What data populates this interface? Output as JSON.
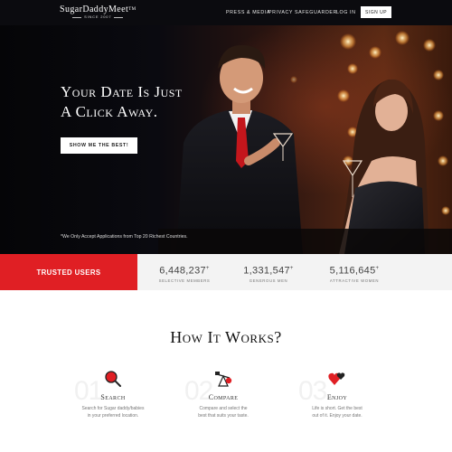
{
  "header": {
    "logo_text": "SugarDaddyMeet",
    "logo_tm": "TM",
    "logo_since": "SINCE 2007",
    "nav_press": "PRESS & MEDIA",
    "nav_privacy": "PRIVACY SAFEGUARDER",
    "nav_login": "LOG IN",
    "signup_label": "SIGN UP"
  },
  "hero": {
    "title_line1": "Your Date Is Just",
    "title_line2": "A Click Away.",
    "cta_label": "SHOW ME THE BEST!",
    "note": "*We Only Accept Applications from Top 20 Richest Countries."
  },
  "stats": {
    "trusted_label": "TRUSTED USERS",
    "items": [
      {
        "value": "6,448,237",
        "plus": "+",
        "label": "SELECTIVE MEMBERS"
      },
      {
        "value": "1,331,547",
        "plus": "+",
        "label": "GENEROUS MEN"
      },
      {
        "value": "5,116,645",
        "plus": "+",
        "label": "ATTRACTIVE WOMEN"
      }
    ]
  },
  "how": {
    "title": "How It Works?",
    "steps": [
      {
        "num": "01",
        "name": "Search",
        "desc_line1": "Search for Sugar daddy/babies",
        "desc_line2": "in your preferred location.",
        "icon": "magnifier-icon"
      },
      {
        "num": "02",
        "name": "Compare",
        "desc_line1": "Compare and select the",
        "desc_line2": "best that suits your taste.",
        "icon": "balance-icon"
      },
      {
        "num": "03",
        "name": "Enjoy",
        "desc_line1": "Life is short. Get the best",
        "desc_line2": "out of it. Enjoy your date.",
        "icon": "hearts-icon"
      }
    ]
  },
  "colors": {
    "accent": "#e01f24",
    "header_bg": "#0b0b0f"
  }
}
